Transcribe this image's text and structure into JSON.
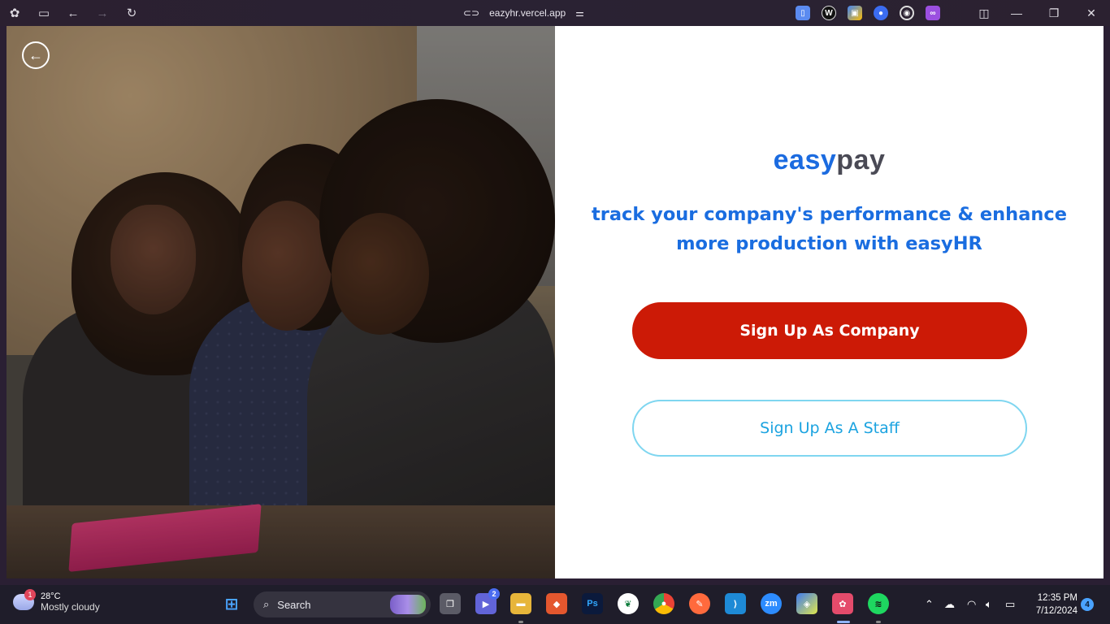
{
  "browser": {
    "url": "eazyhr.vercel.app"
  },
  "page": {
    "logo": {
      "part1": "easy",
      "part2": "pay"
    },
    "tagline_line1": "track your company's performance & enhance",
    "tagline_line2": "more production with easyHR",
    "company_button": "Sign Up As Company",
    "staff_button": "Sign Up As A Staff"
  },
  "taskbar": {
    "weather": {
      "temp": "28°C",
      "condition": "Mostly cloudy",
      "badge": "1"
    },
    "search_placeholder": "Search",
    "teams_badge": "2",
    "clock": {
      "time": "12:35 PM",
      "date": "7/12/2024"
    },
    "notifications": "4"
  }
}
